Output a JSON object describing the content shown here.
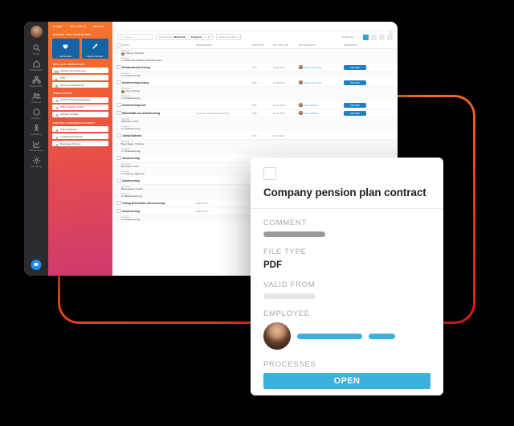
{
  "window": {
    "rail": {
      "items": [
        {
          "label": "Suche",
          "icon": "search-icon"
        },
        {
          "label": "Arbeitsplatz",
          "icon": "home-icon"
        },
        {
          "label": "Organisation",
          "icon": "org-icon"
        },
        {
          "label": "Personal",
          "icon": "people-icon"
        },
        {
          "label": "Prozesse",
          "icon": "circle-icon"
        },
        {
          "label": "Ausbildung",
          "icon": "graduation-icon"
        },
        {
          "label": "Weiterbildung",
          "icon": "chart-icon"
        },
        {
          "label": "Verwaltung",
          "icon": "gear-icon"
        }
      ],
      "chat_icon": "chat-icon",
      "avatar": "avatar"
    },
    "panel": {
      "tabs": [
        "Cockpit",
        "Mein HELIX",
        "Mensch"
      ],
      "sections": [
        {
          "heading": "UNSERE STELLENBÖRSEN",
          "type": "tiles",
          "tiles": [
            {
              "label": "Karriereseite",
              "icon": "heart-icon"
            },
            {
              "label": "Internes Karriere",
              "icon": "rocket-icon"
            }
          ]
        },
        {
          "heading": "STELLEN VERWALTEN",
          "type": "rows",
          "rows": [
            {
              "label": "Stellenausschreibungen",
              "icon": "list-icon"
            },
            {
              "label": "KPIs",
              "icon": "kpi-icon"
            },
            {
              "label": "Kosten je Stellenbörse",
              "icon": "coin-icon"
            }
          ]
        },
        {
          "heading": "ONBOARDING",
          "type": "rows",
          "rows": [
            {
              "label": "Offene Onboardingaufgaben",
              "icon": "arrow-icon"
            },
            {
              "label": "Offene Digitale Inhalte",
              "icon": "arrow-icon"
            },
            {
              "label": "Aktuelle Verträge",
              "icon": "arrow-icon"
            }
          ]
        },
        {
          "heading": "EMPFEHLUNGSMANAGEMENT",
          "type": "rows",
          "rows": [
            {
              "label": "Prämienkatalog",
              "icon": "arrow-icon"
            },
            {
              "label": "Leaderboard (Monat)",
              "icon": "arrow-icon"
            },
            {
              "label": "Beantrage Prämien",
              "icon": "arrow-icon"
            }
          ]
        }
      ]
    },
    "toolbar": {
      "search_placeholder": "Suchen...",
      "group_label": "Gruppierung",
      "chip1_label": "Mitarbeiter",
      "chip2_label": "Kategorie",
      "chip_remove": "✕",
      "add_icon": "plus-box-icon",
      "sort_label": "Sortierung nach",
      "page_label": "50 Einträge",
      "prev_icon": "chevron-left-icon",
      "next_icon": "chevron-right-icon",
      "view_buttons": [
        "grid-view-icon",
        "list-view-icon",
        "card-view-icon",
        "table-view-icon"
      ],
      "active_view": 0,
      "export_icon": "export-icon"
    },
    "table": {
      "columns": [
        "NAME",
        "BEMERKUNG",
        "DATEITYP",
        "GÜLTIG VON",
        "MITARBEITER",
        "PROZESSE"
      ],
      "sort_icon": "sort-arrow-icon",
      "rows": [
        {
          "kind": "group",
          "key": "Mitarbeiter",
          "value": "Assing, Veronika",
          "avatar": true
        },
        {
          "kind": "group",
          "key": "Kategorie",
          "value": "1.3 Stammbezahlbare Veränderungen"
        },
        {
          "kind": "row",
          "name": "Heiratsurkunde Assing",
          "note": "",
          "type": "JPG",
          "date": "03.06.2017",
          "employee": "Assing, Veronika",
          "action": "ÖFFNEN"
        },
        {
          "kind": "group",
          "key": "Kategorie",
          "value": "2.1 Arbeitsvertrag"
        },
        {
          "kind": "row",
          "name": "Arbeitsvertrag Assing",
          "note": "",
          "type": "PDF",
          "date": "01.08.2022",
          "employee": "Assing, Veronika",
          "action": "ÖFFNEN"
        },
        {
          "kind": "group",
          "key": "Mitarbeiter",
          "value": "Auer, Norbert",
          "avatar": true
        },
        {
          "kind": "group",
          "key": "Kategorie",
          "value": "2.1 Arbeitsvertrag"
        },
        {
          "kind": "row",
          "name": "Arbeitsvertrag Auer",
          "note": "",
          "type": "PDF",
          "date": "01.01.2020",
          "employee": "Auer, Norbert",
          "action": "ÖFFNEN"
        },
        {
          "kind": "row",
          "name": "Nationalität zum Arbeitsvertrag",
          "note": "Regel für Außendienstzuschlag",
          "type": "PDF",
          "date": "01.01.2020",
          "employee": "Auer, Norbert",
          "action": "ÖFFNEN"
        },
        {
          "kind": "group",
          "key": "Mitarbeiter",
          "value": "Bachuber, Areal"
        },
        {
          "kind": "group",
          "key": "Kategorie",
          "value": "2.1 Arbeitsvertrag"
        },
        {
          "kind": "row",
          "name": "Jobrad Bafunde",
          "note": "",
          "type": "PDF",
          "date": "01.04.2021",
          "employee": "",
          "action": ""
        },
        {
          "kind": "group",
          "key": "Mitarbeiter",
          "value": "Baumhagel, Christine"
        },
        {
          "kind": "group",
          "key": "Kategorie",
          "value": "2.1 Arbeitsvertrag"
        },
        {
          "kind": "row",
          "name": "Arbeitsvertrag",
          "note": "",
          "type": "",
          "date": "",
          "employee": "",
          "action": ""
        },
        {
          "kind": "group",
          "key": "Mitarbeiter",
          "value": "Bernhard, Ulrich"
        },
        {
          "kind": "group",
          "key": "Kategorie",
          "value": "1.1 Vertrag, allgemein"
        },
        {
          "kind": "row",
          "name": "Arbeitsvertrag",
          "note": "",
          "type": "",
          "date": "",
          "employee": "",
          "action": ""
        },
        {
          "kind": "group",
          "key": "Mitarbeiter",
          "value": "Baumgartner, Ingrid"
        },
        {
          "kind": "group",
          "key": "Kategorie",
          "value": "2.0 Betriebsführung"
        },
        {
          "kind": "row",
          "name": "Vertrag Betriebliche Altersvorsorge",
          "note": "Stand 2017",
          "type": "PDF",
          "date": "",
          "employee": "",
          "action": ""
        },
        {
          "kind": "row",
          "name": "Arbeitsvertrag",
          "note": "Stand 2017",
          "type": "PDF",
          "date": "",
          "employee": "",
          "action": ""
        },
        {
          "kind": "group",
          "key": "Kategorie",
          "value": "2.1 Arbeitsvertrag"
        }
      ]
    }
  },
  "card": {
    "checkbox": "unchecked",
    "title": "Company pension plan contract",
    "fields": [
      {
        "label": "COMMENT",
        "kind": "bar-dark",
        "value": ""
      },
      {
        "label": "FILE TYPE",
        "kind": "text",
        "value": "PDF"
      },
      {
        "label": "VALID FROM",
        "kind": "bar-light",
        "value": ""
      },
      {
        "label": "EMPLOYEE",
        "kind": "employee",
        "value": ""
      },
      {
        "label": "PROCESSES",
        "kind": "button",
        "value": "OPEN"
      }
    ],
    "accent_color": "#3bb0dd"
  },
  "decor": {
    "frame_gradient_from": "#f08c1a",
    "frame_gradient_to": "#e01b1b"
  }
}
